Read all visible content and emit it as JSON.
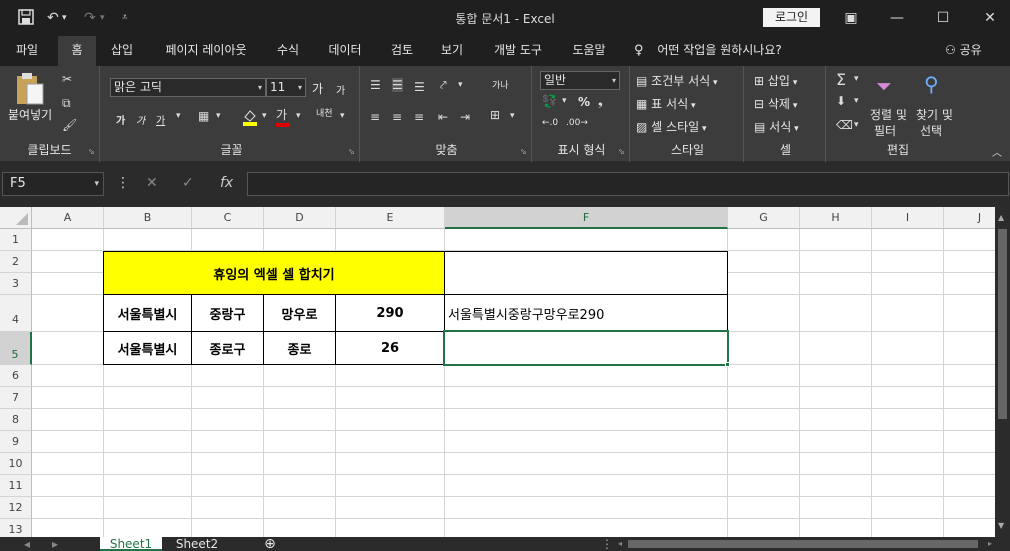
{
  "titlebar": {
    "title": "통합 문서1  -  Excel",
    "login": "로그인",
    "save_icon": "save-icon",
    "undo_icon": "undo-icon",
    "redo_icon": "redo-icon"
  },
  "tabs": [
    {
      "label": "파일"
    },
    {
      "label": "홈"
    },
    {
      "label": "삽입"
    },
    {
      "label": "페이지 레이아웃"
    },
    {
      "label": "수식"
    },
    {
      "label": "데이터"
    },
    {
      "label": "검토"
    },
    {
      "label": "보기"
    },
    {
      "label": "개발 도구"
    },
    {
      "label": "도움말"
    }
  ],
  "tell_me": "어떤 작업을 원하시나요?",
  "share": "공유",
  "ribbon": {
    "clipboard": {
      "label": "클립보드",
      "paste": "붙여넣기"
    },
    "font": {
      "label": "글꼴",
      "font_name": "맑은 고딕",
      "font_size": "11",
      "grow": "가",
      "shrink": "가",
      "bold": "가",
      "italic": "가",
      "underline": "가",
      "font_color": "가",
      "phonetic": "내천"
    },
    "align": {
      "label": "맞춤",
      "wrap": "가나"
    },
    "number": {
      "label": "표시 형식",
      "format": "일반",
      "percent": "%"
    },
    "styles": {
      "label": "스타일",
      "cond": "조건부 서식",
      "table": "표 서식",
      "cell": "셀 스타일"
    },
    "cells": {
      "label": "셀",
      "insert": "삽입",
      "delete": "삭제",
      "format": "서식"
    },
    "edit": {
      "label": "편집",
      "sort": "정렬 및",
      "sort2": "필터",
      "find": "찾기 및",
      "find2": "선택"
    }
  },
  "formula_bar": {
    "name_box": "F5",
    "formula": "",
    "fx": "fx"
  },
  "columns": [
    "A",
    "B",
    "C",
    "D",
    "E",
    "F",
    "G",
    "H",
    "I",
    "J"
  ],
  "rows": [
    "1",
    "2",
    "3",
    "4",
    "5",
    "6",
    "7",
    "8",
    "9",
    "10",
    "11",
    "12",
    "13"
  ],
  "selected_cell": "F5",
  "cells": {
    "title": "휴잉의 엑셀 셀 합치기",
    "b4": "서울특별시",
    "c4": "중랑구",
    "d4": "망우로",
    "e4": "290",
    "f4": "서울특별시중랑구망우로290",
    "b5": "서울특별시",
    "c5": "종로구",
    "d5": "종로",
    "e5": "26"
  },
  "sheets": [
    {
      "name": "Sheet1"
    },
    {
      "name": "Sheet2"
    }
  ],
  "colors": {
    "accent": "#217346",
    "highlight": "#ffff00"
  }
}
